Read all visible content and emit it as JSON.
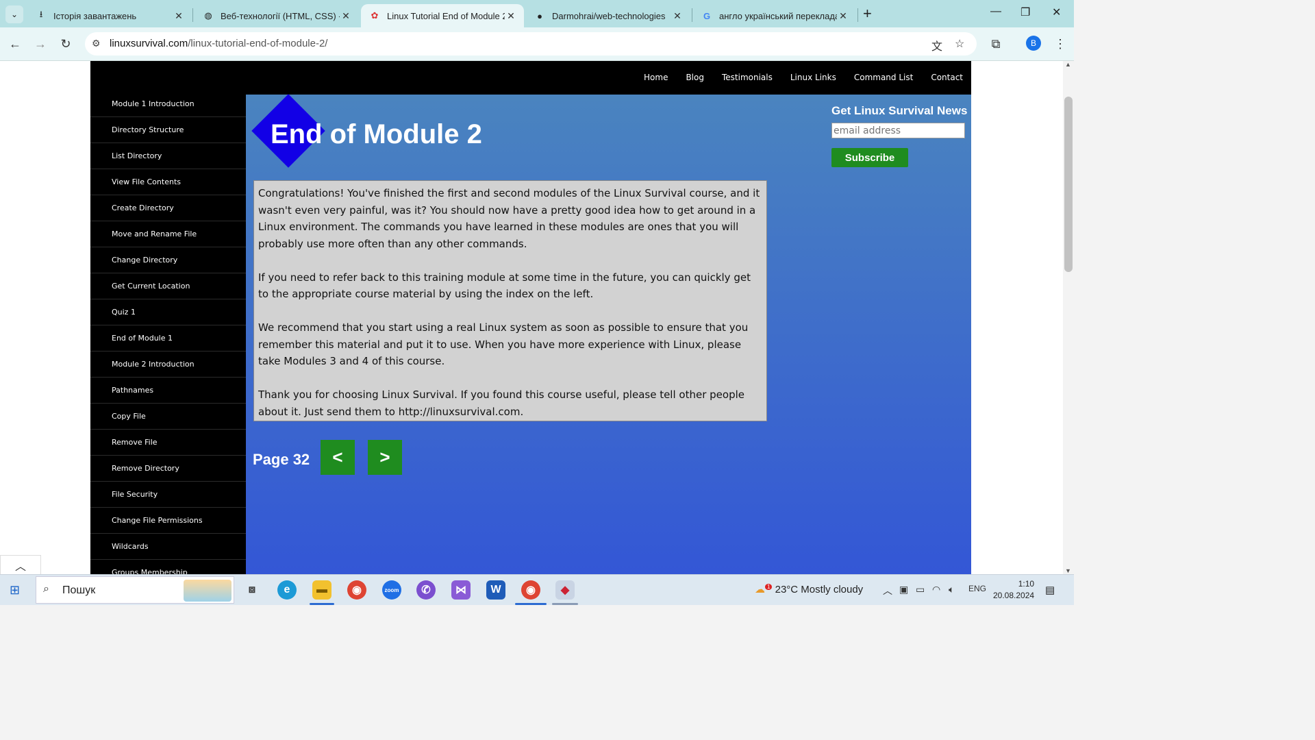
{
  "browser": {
    "tabs": [
      {
        "title": "Історія завантажень",
        "icon": "download-icon",
        "active": false
      },
      {
        "title": "Веб-технології (HTML, CSS) - Л",
        "icon": "globe-icon",
        "active": false
      },
      {
        "title": "Linux Tutorial End of Module 2",
        "icon": "linux-survival-favicon",
        "active": true
      },
      {
        "title": "Darmohrai/web-technologies",
        "icon": "github-icon",
        "active": false
      },
      {
        "title": "англо український переклада",
        "icon": "google-icon",
        "active": false
      }
    ],
    "url_host": "linuxsurvival.com",
    "url_path": "/linux-tutorial-end-of-module-2/",
    "profile_initial": "B"
  },
  "site": {
    "nav": [
      "Home",
      "Blog",
      "Testimonials",
      "Linux Links",
      "Command List",
      "Contact"
    ],
    "sidebar": [
      "Module 1 Introduction",
      "Directory Structure",
      "List Directory",
      "View File Contents",
      "Create Directory",
      "Move and Rename File",
      "Change Directory",
      "Get Current Location",
      "Quiz 1",
      "End of Module 1",
      "Module 2 Introduction",
      "Pathnames",
      "Copy File",
      "Remove File",
      "Remove Directory",
      "File Security",
      "Change File Permissions",
      "Wildcards",
      "Groups Membership"
    ],
    "headline": "End of Module 2",
    "paragraphs": [
      "Congratulations! You've finished the first and second modules of the Linux Survival course, and it wasn't even very painful, was it? You should now have a pretty good idea how to get around in a Linux environment. The commands you have learned in these modules are ones that you will probably use more often than any other commands.",
      "If you need to refer back to this training module at some time in the future, you can quickly get to the appropriate course material by using the index on the left.",
      "We recommend that you start using a real Linux system as soon as possible to ensure that you remember this material and put it to use. When you have more experience with Linux, please take Modules 3 and 4 of this course.",
      "Thank you for choosing Linux Survival. If you found this course useful, please tell other people about it. Just send them to http://linuxsurvival.com."
    ],
    "page_label": "Page 32",
    "prev_label": "<",
    "next_label": ">",
    "news": {
      "title": "Get Linux Survival News",
      "email_placeholder": "email address",
      "subscribe_label": "Subscribe"
    }
  },
  "taskbar": {
    "search_placeholder": "Пошук",
    "weather": "23°C  Mostly cloudy",
    "weather_badge": "1",
    "language": "ENG",
    "time": "1:10",
    "date": "20.08.2024"
  },
  "colors": {
    "accent_green": "#1f8c1f",
    "diamond_blue": "#1200e6",
    "gradient_top": "#4a84bf",
    "gradient_bottom": "#3356d6"
  }
}
